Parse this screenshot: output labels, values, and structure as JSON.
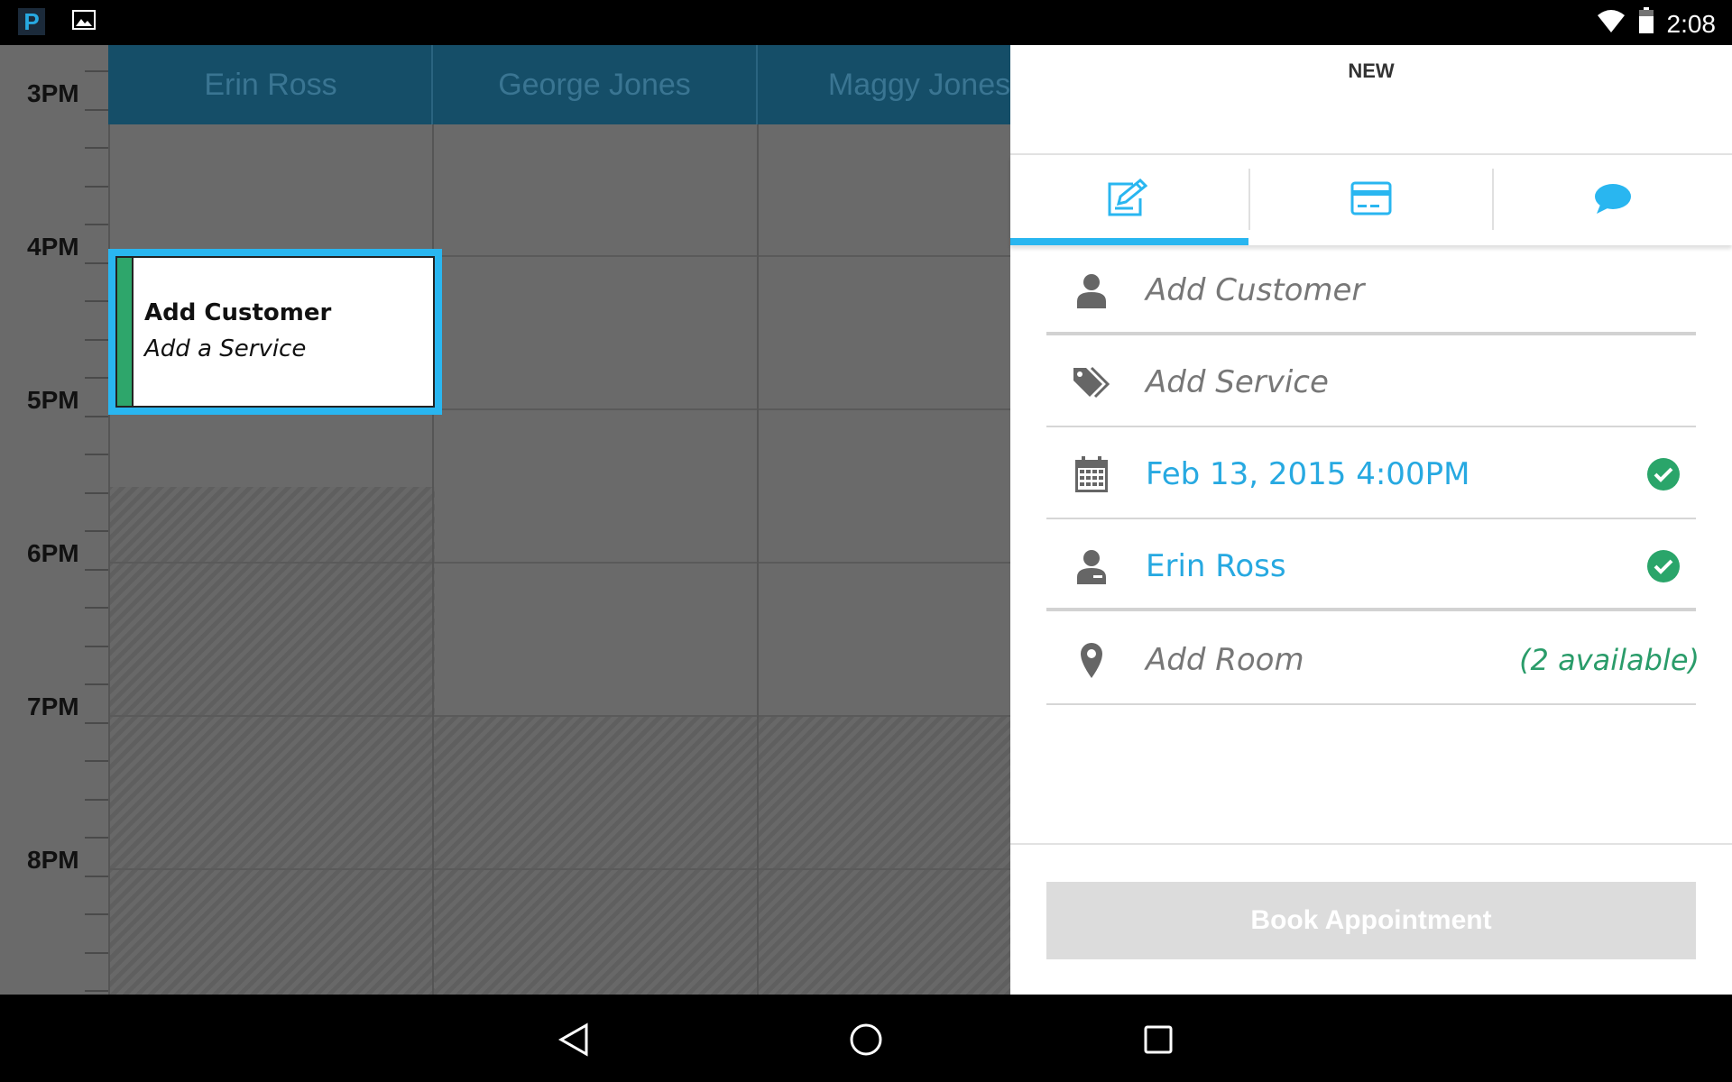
{
  "status_bar": {
    "app_icon": "P",
    "notification_icons": [
      "app-p-icon",
      "image-icon"
    ],
    "clock": "2:08",
    "indicators": [
      "wifi-icon",
      "battery-icon"
    ]
  },
  "calendar": {
    "time_labels": [
      "3PM",
      "4PM",
      "5PM",
      "6PM",
      "7PM",
      "8PM"
    ],
    "staff": [
      {
        "name": "Erin Ross"
      },
      {
        "name": "George Jones"
      },
      {
        "name": "Maggy Jones"
      }
    ],
    "selected_block": {
      "title": "Add Customer",
      "subtitle": "Add a Service",
      "stripe_color": "#2ea66b",
      "border_color": "#29b6f0"
    }
  },
  "panel": {
    "title": "NEW",
    "tabs": [
      {
        "icon": "edit-icon",
        "active": true
      },
      {
        "icon": "credit-card-icon",
        "active": false
      },
      {
        "icon": "chat-bubble-icon",
        "active": false
      }
    ],
    "fields": {
      "customer": {
        "placeholder": "Add Customer",
        "icon": "person-icon"
      },
      "service": {
        "placeholder": "Add Service",
        "icon": "tags-icon"
      },
      "datetime": {
        "value": "Feb 13, 2015 4:00PM",
        "icon": "calendar-icon",
        "confirmed": true
      },
      "staff": {
        "value": "Erin Ross",
        "icon": "staff-person-icon",
        "confirmed": true
      },
      "room": {
        "placeholder": "Add Room",
        "icon": "map-pin-icon",
        "availability": "(2 available)"
      }
    },
    "book_button": "Book Appointment"
  },
  "colors": {
    "accent": "#29b6f0",
    "header": "#154e68",
    "success": "#2aa56a"
  },
  "nav_bar": [
    "back-icon",
    "home-icon",
    "recents-icon"
  ]
}
